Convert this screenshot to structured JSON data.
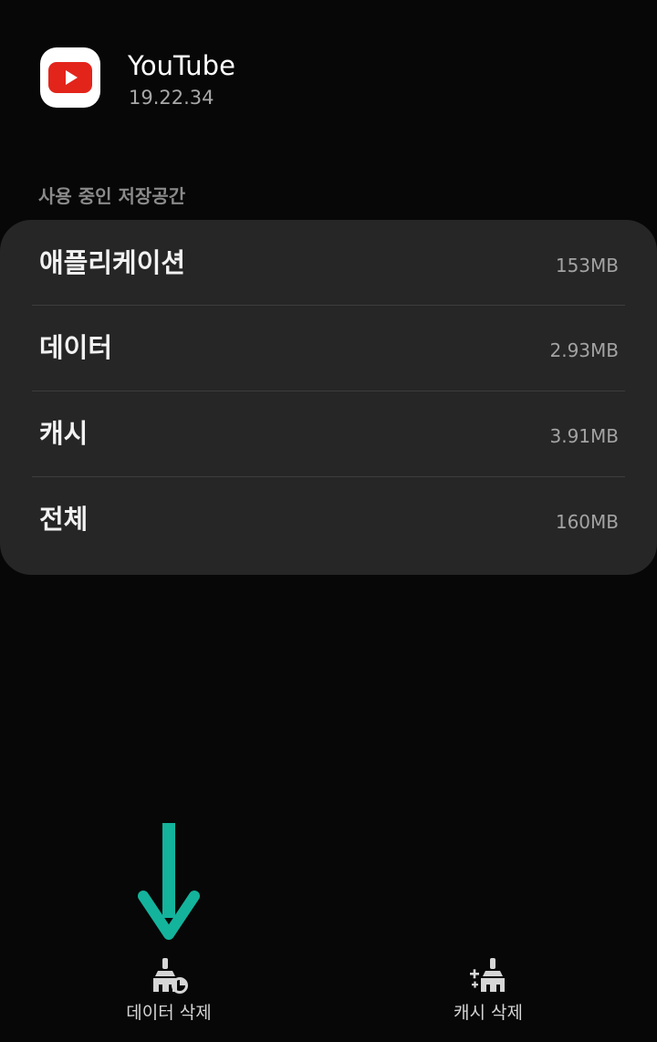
{
  "app": {
    "name": "YouTube",
    "version": "19.22.34",
    "icon": "youtube-logo-icon"
  },
  "storage": {
    "section_title": "사용 중인 저장공간",
    "rows": [
      {
        "label": "애플리케이션",
        "value": "153MB"
      },
      {
        "label": "데이터",
        "value": "2.93MB"
      },
      {
        "label": "캐시",
        "value": "3.91MB"
      },
      {
        "label": "전체",
        "value": "160MB"
      }
    ]
  },
  "actions": {
    "clear_data": {
      "label": "데이터 삭제",
      "icon": "clear-data-broom-icon"
    },
    "clear_cache": {
      "label": "캐시 삭제",
      "icon": "clear-cache-broom-icon"
    }
  },
  "colors": {
    "background": "#070707",
    "card": "#262626",
    "annotation_arrow": "#14b39c",
    "youtube_red": "#e3241b"
  }
}
